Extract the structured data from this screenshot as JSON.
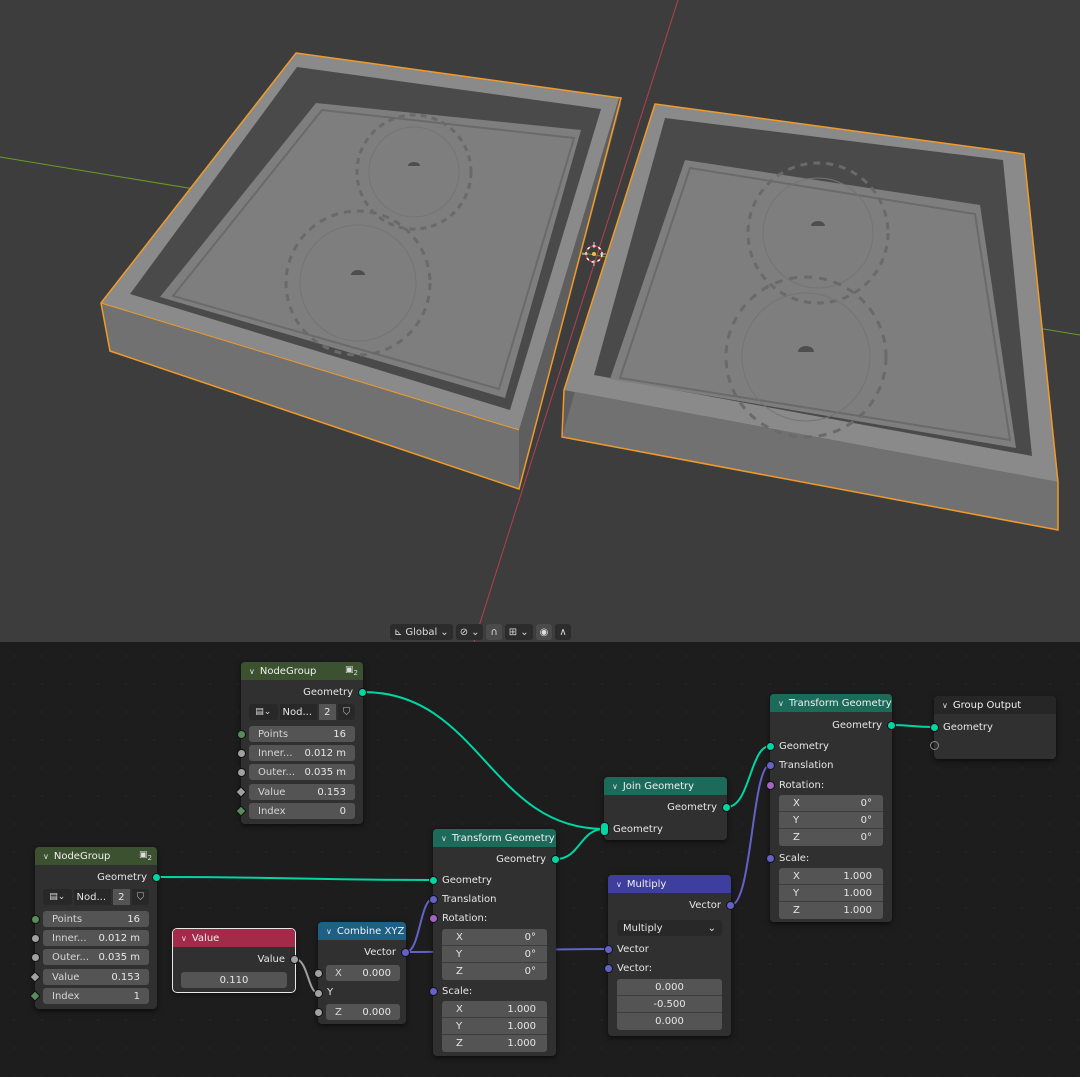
{
  "viewport": {
    "colors": {
      "background": "#3d3d3d",
      "object": "#7c7c7c",
      "selection": "#f09a2a",
      "x_axis": "#b4404c",
      "y_axis": "#6a9a2a"
    },
    "header": {
      "orientation_label": "Global"
    }
  },
  "node_editor": {
    "colors": {
      "group_header": "#3b5130",
      "transform_header": "#1c6b5a",
      "join_header": "#1c6b5a",
      "output_header": "#262626",
      "value_header": "#a32a48",
      "combine_header": "#1e5f86",
      "multiply_header": "#3e3e9e",
      "geometry_wire": "#00d6a3",
      "vector_wire": "#6363c7"
    },
    "nodes": {
      "group_top": {
        "title": "NodeGroup",
        "user_count": "2",
        "out_geometry": "Geometry",
        "datablock_name": "Nod...",
        "datablock_users": "2",
        "inputs": [
          {
            "name": "Points",
            "value": "16"
          },
          {
            "name": "Inner...",
            "value": "0.012 m"
          },
          {
            "name": "Outer...",
            "value": "0.035 m"
          },
          {
            "name": "Value",
            "value": "0.153"
          },
          {
            "name": "Index",
            "value": "0"
          }
        ]
      },
      "group_bottom": {
        "title": "NodeGroup",
        "user_count": "2",
        "out_geometry": "Geometry",
        "datablock_name": "Nod...",
        "datablock_users": "2",
        "inputs": [
          {
            "name": "Points",
            "value": "16"
          },
          {
            "name": "Inner...",
            "value": "0.012 m"
          },
          {
            "name": "Outer...",
            "value": "0.035 m"
          },
          {
            "name": "Value",
            "value": "0.153"
          },
          {
            "name": "Index",
            "value": "1"
          }
        ]
      },
      "value": {
        "title": "Value",
        "out_value": "Value",
        "value": "0.110"
      },
      "combine_xyz": {
        "title": "Combine XYZ",
        "out_vector": "Vector",
        "x_label": "X",
        "x_value": "0.000",
        "y_label": "Y",
        "z_label": "Z",
        "z_value": "0.000"
      },
      "transform_left": {
        "title": "Transform Geometry",
        "out_geometry": "Geometry",
        "in_geometry": "Geometry",
        "translation": "Translation",
        "rotation": "Rotation:",
        "rot": [
          {
            "axis": "X",
            "value": "0°"
          },
          {
            "axis": "Y",
            "value": "0°"
          },
          {
            "axis": "Z",
            "value": "0°"
          }
        ],
        "scale_label": "Scale:",
        "scale": [
          {
            "axis": "X",
            "value": "1.000"
          },
          {
            "axis": "Y",
            "value": "1.000"
          },
          {
            "axis": "Z",
            "value": "1.000"
          }
        ]
      },
      "join": {
        "title": "Join Geometry",
        "out_geometry": "Geometry",
        "in_geometry": "Geometry"
      },
      "multiply": {
        "title": "Multiply",
        "out_vector": "Vector",
        "operation": "Multiply",
        "in_vector": "Vector",
        "in_vector2": "Vector:",
        "values": [
          "0.000",
          "-0.500",
          "0.000"
        ]
      },
      "transform_right": {
        "title": "Transform Geometry",
        "out_geometry": "Geometry",
        "in_geometry": "Geometry",
        "translation": "Translation",
        "rotation": "Rotation:",
        "rot": [
          {
            "axis": "X",
            "value": "0°"
          },
          {
            "axis": "Y",
            "value": "0°"
          },
          {
            "axis": "Z",
            "value": "0°"
          }
        ],
        "scale_label": "Scale:",
        "scale": [
          {
            "axis": "X",
            "value": "1.000"
          },
          {
            "axis": "Y",
            "value": "1.000"
          },
          {
            "axis": "Z",
            "value": "1.000"
          }
        ]
      },
      "group_output": {
        "title": "Group Output",
        "in_geometry": "Geometry"
      }
    }
  }
}
